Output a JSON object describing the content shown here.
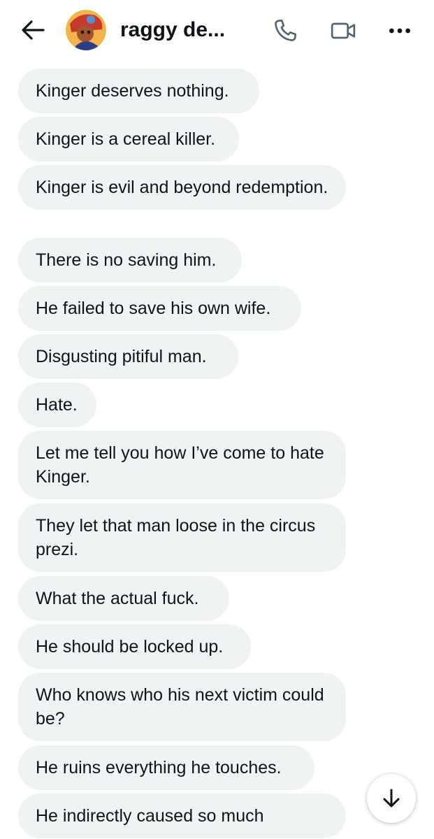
{
  "header": {
    "title": "raggy de...",
    "back_icon": "arrow-left-icon",
    "call_icon": "phone-icon",
    "video_icon": "video-camera-icon",
    "more_icon": "more-horizontal-icon"
  },
  "messages": [
    {
      "text": "Kinger deserves nothing."
    },
    {
      "text": "Kinger is a cereal killer."
    },
    {
      "text": "Kinger is evil and beyond redemption."
    },
    {
      "text": "There is no saving him."
    },
    {
      "text": "He failed to save his own wife."
    },
    {
      "text": "Disgusting pitiful man."
    },
    {
      "text": "Hate."
    },
    {
      "text": "Let me tell you how I’ve come to hate Kinger."
    },
    {
      "text": "They let that man loose in the circus prezi."
    },
    {
      "text": "What the actual fuck."
    },
    {
      "text": "He should be locked up."
    },
    {
      "text": "Who knows who his next victim could be?"
    },
    {
      "text": "He ruins everything he touches."
    },
    {
      "text": "He indirectly caused so much"
    }
  ],
  "scroll_down_icon": "arrow-down-icon",
  "colors": {
    "bubble_bg": "#eff3f4",
    "text": "#0f1419",
    "icon": "#0f1419",
    "secondary_icon": "#536471"
  }
}
